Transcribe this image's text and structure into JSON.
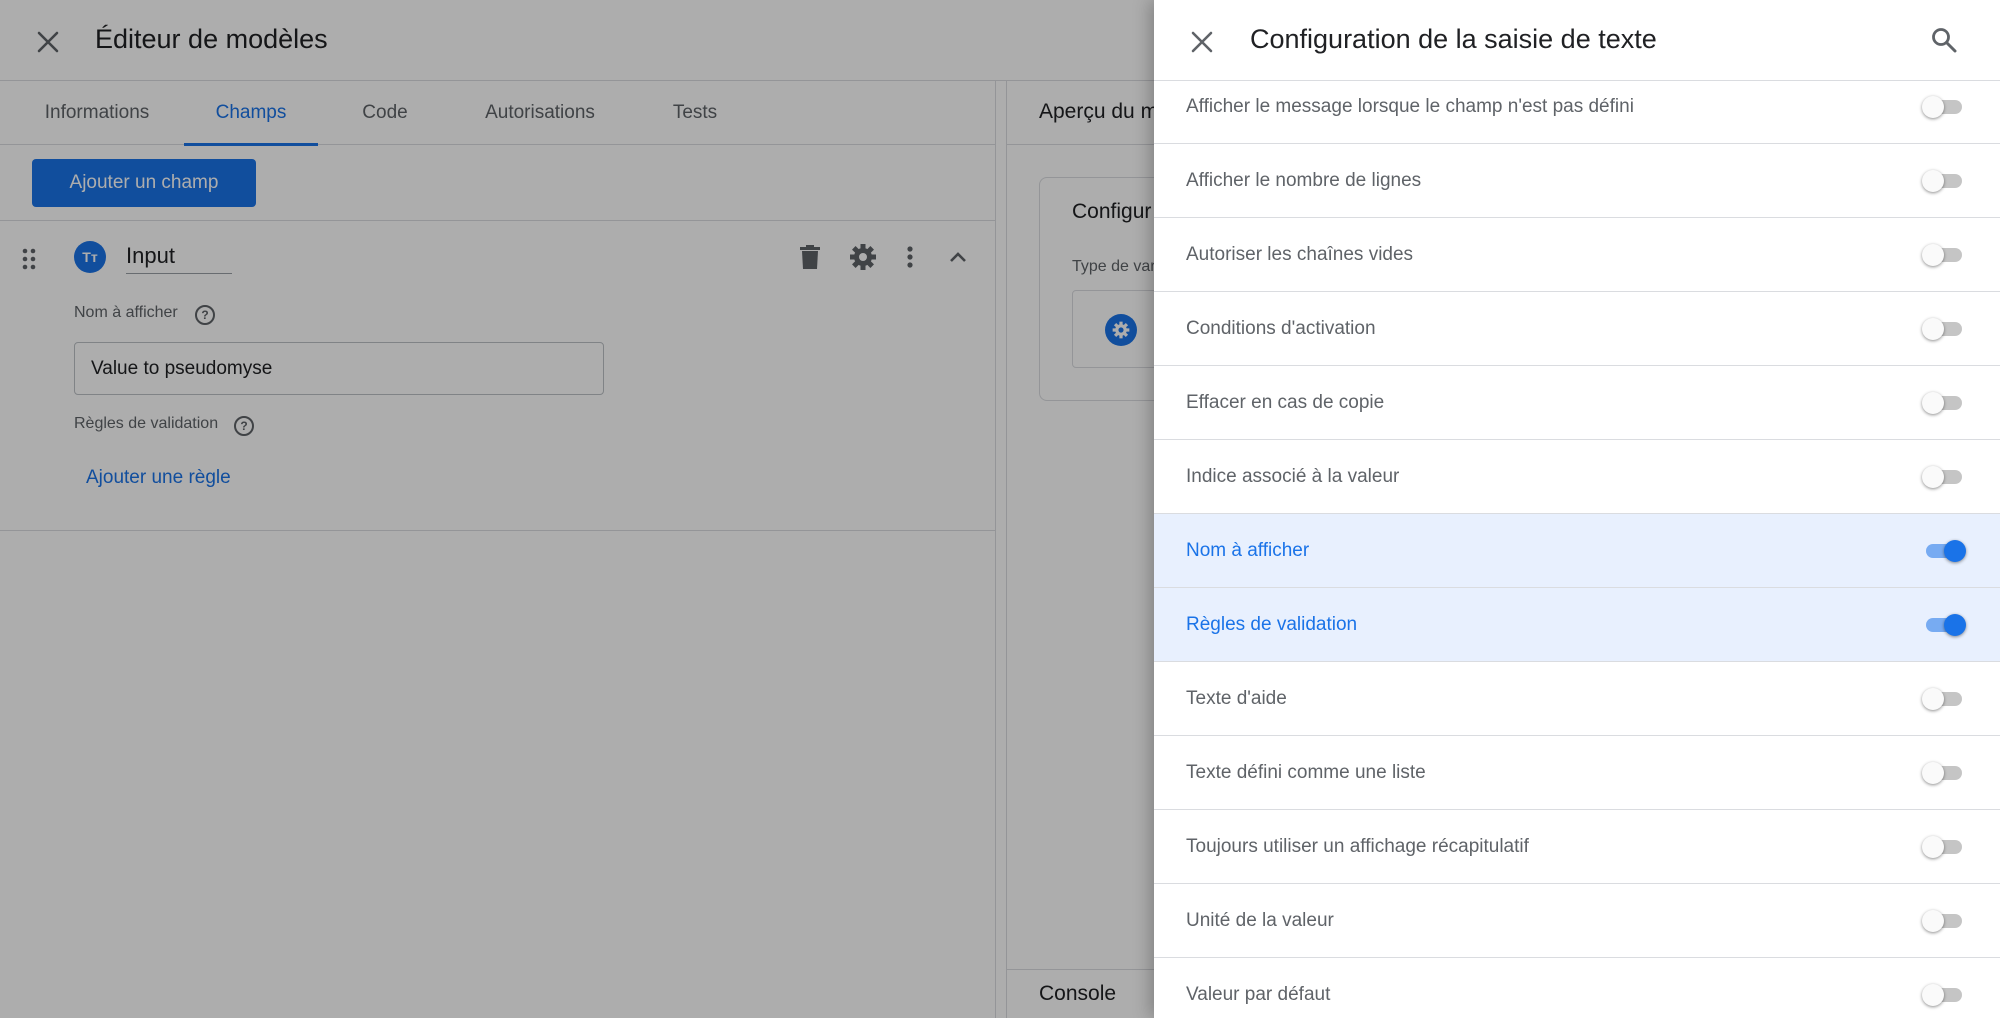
{
  "editor": {
    "title": "Éditeur de modèles",
    "tabs": [
      "Informations",
      "Champs",
      "Code",
      "Autorisations",
      "Tests"
    ],
    "active_tab": "Champs",
    "add_field_label": "Ajouter un champ",
    "field": {
      "type_badge": "Tт",
      "name": "Input",
      "display_name_label": "Nom à afficher",
      "display_name_value": "Value to pseudomyse",
      "validation_label": "Règles de validation",
      "add_rule_label": "Ajouter une règle"
    },
    "preview": {
      "title": "Aperçu du m",
      "card_title": "Configur",
      "var_type_label": "Type de var"
    },
    "console_label": "Console"
  },
  "panel": {
    "title": "Configuration de la saisie de texte",
    "settings": [
      {
        "label": "Afficher le message lorsque le champ n'est pas défini",
        "on": false
      },
      {
        "label": "Afficher le nombre de lignes",
        "on": false
      },
      {
        "label": "Autoriser les chaînes vides",
        "on": false
      },
      {
        "label": "Conditions d'activation",
        "on": false
      },
      {
        "label": "Effacer en cas de copie",
        "on": false
      },
      {
        "label": "Indice associé à la valeur",
        "on": false
      },
      {
        "label": "Nom à afficher",
        "on": true
      },
      {
        "label": "Règles de validation",
        "on": true
      },
      {
        "label": "Texte d'aide",
        "on": false
      },
      {
        "label": "Texte défini comme une liste",
        "on": false
      },
      {
        "label": "Toujours utiliser un affichage récapitulatif",
        "on": false
      },
      {
        "label": "Unité de la valeur",
        "on": false
      },
      {
        "label": "Valeur par défaut",
        "on": false
      }
    ]
  },
  "colors": {
    "accent": "#1a73e8",
    "active_row": "#e8f0fe",
    "text_secondary": "#5f6368"
  }
}
